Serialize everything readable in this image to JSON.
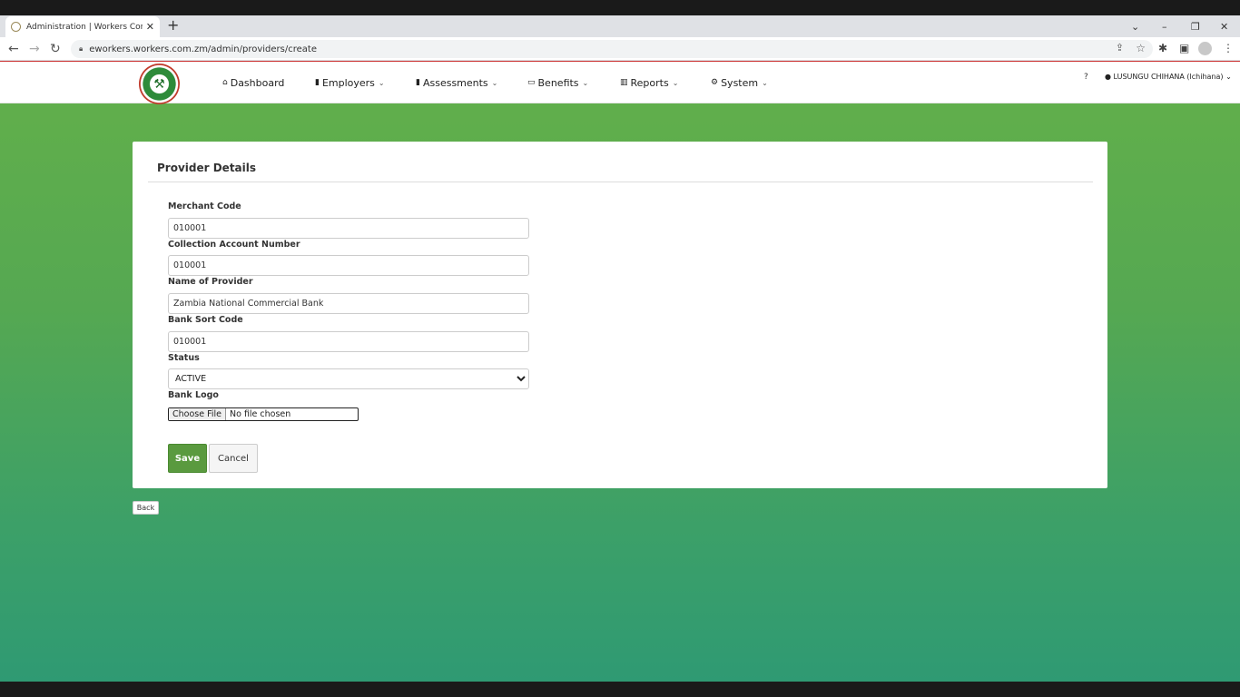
{
  "browser": {
    "tab_title": "Administration | Workers Compe",
    "tab_close": "✕",
    "new_tab": "+",
    "url": "eworkers.workers.com.zm/admin/providers/create"
  },
  "nav": {
    "items": [
      {
        "icon": "home-icon",
        "label": "Dashboard"
      },
      {
        "icon": "building-icon",
        "label": "Employers"
      },
      {
        "icon": "file-icon",
        "label": "Assessments"
      },
      {
        "icon": "money-icon",
        "label": "Benefits"
      },
      {
        "icon": "bar-chart-icon",
        "label": "Reports"
      },
      {
        "icon": "cogs-icon",
        "label": "System"
      }
    ],
    "user_label": "LUSUNGU CHIHANA (lchihana)"
  },
  "form": {
    "title": "Provider Details",
    "merchant_code_label": "Merchant Code",
    "merchant_code_value": "010001",
    "collection_account_label": "Collection Account Number",
    "collection_account_value": "010001",
    "provider_name_label": "Name of Provider",
    "provider_name_value": "Zambia National Commercial Bank",
    "sort_code_label": "Bank Sort Code",
    "sort_code_value": "010001",
    "status_label": "Status",
    "status_value": "ACTIVE",
    "bank_logo_label": "Bank Logo",
    "choose_file_label": "Choose File",
    "file_status": "No file chosen",
    "save_label": "Save",
    "cancel_label": "Cancel"
  },
  "back_label": "Back"
}
